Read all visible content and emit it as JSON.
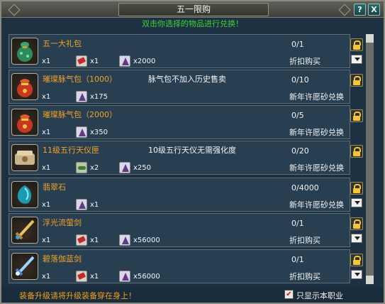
{
  "window": {
    "title": "五一限购",
    "help_label": "?",
    "close_label": "X"
  },
  "hint": "双击你选择的物品进行兑换！",
  "items": [
    {
      "name": "五一大礼包",
      "icon": "green-gift-bag-icon",
      "note": "",
      "counter": "0/1",
      "action": "折扣购买",
      "costs": [
        {
          "icon": "red-ticket-icon",
          "qty": "x1"
        },
        {
          "icon": "purple-crystal-icon",
          "qty": "x2000"
        }
      ],
      "left_qty": "x1",
      "has_dropdown": true
    },
    {
      "name": "璀璨脉气包（1000）",
      "icon": "red-pouch-icon",
      "note": "脉气包不加入历史售卖",
      "counter": "0/10",
      "action": "新年许愿砂兑换",
      "costs": [
        {
          "icon": "purple-crystal-icon",
          "qty": "x175"
        }
      ],
      "left_qty": "x1",
      "has_dropdown": false
    },
    {
      "name": "璀璨脉气包（2000）",
      "icon": "red-pouch-icon",
      "note": "",
      "counter": "0/5",
      "action": "新年许愿砂兑换",
      "costs": [
        {
          "icon": "purple-crystal-icon",
          "qty": "x350"
        }
      ],
      "left_qty": "x1",
      "has_dropdown": false
    },
    {
      "name": "11级五行天仪匣",
      "icon": "jade-box-icon",
      "note": "10级五行天仪无需强化度",
      "counter": "0/20",
      "action": "新年许愿砂兑换",
      "costs": [
        {
          "icon": "green-herb-icon",
          "qty": "x2"
        },
        {
          "icon": "purple-crystal-icon",
          "qty": "x250"
        }
      ],
      "left_qty": "x1",
      "has_dropdown": false
    },
    {
      "name": "翡翠石",
      "icon": "teal-gem-icon",
      "note": "",
      "counter": "0/4000",
      "action": "新年许愿砂兑换",
      "costs": [
        {
          "icon": "purple-crystal-icon",
          "qty": "x1"
        }
      ],
      "left_qty": "x1",
      "has_dropdown": true
    },
    {
      "name": "浮光流萤剑",
      "icon": "golden-sword-icon",
      "note": "",
      "counter": "0/1",
      "action": "折扣购买",
      "costs": [
        {
          "icon": "red-ticket-icon",
          "qty": "x1"
        },
        {
          "icon": "purple-crystal-icon",
          "qty": "x56000"
        }
      ],
      "left_qty": "x1",
      "has_dropdown": true
    },
    {
      "name": "碧落伽蓝剑",
      "icon": "blue-sword-icon",
      "note": "",
      "counter": "0/1",
      "action": "折扣购买",
      "costs": [
        {
          "icon": "red-ticket-icon",
          "qty": "x1"
        },
        {
          "icon": "purple-crystal-icon",
          "qty": "x56000"
        }
      ],
      "left_qty": "x1",
      "has_dropdown": true
    }
  ],
  "footer": {
    "note": "装备升级请将升级装备穿在身上！",
    "checkbox_checked": true,
    "checkbox_label": "只显示本职业"
  },
  "colors": {
    "window_bg": "#1d3142",
    "row_bg": "#283f52",
    "item_name": "#f2a028",
    "hint_green": "#3fd23a",
    "footer_orange": "#f0a020",
    "lock_gold": "#f4c534"
  }
}
